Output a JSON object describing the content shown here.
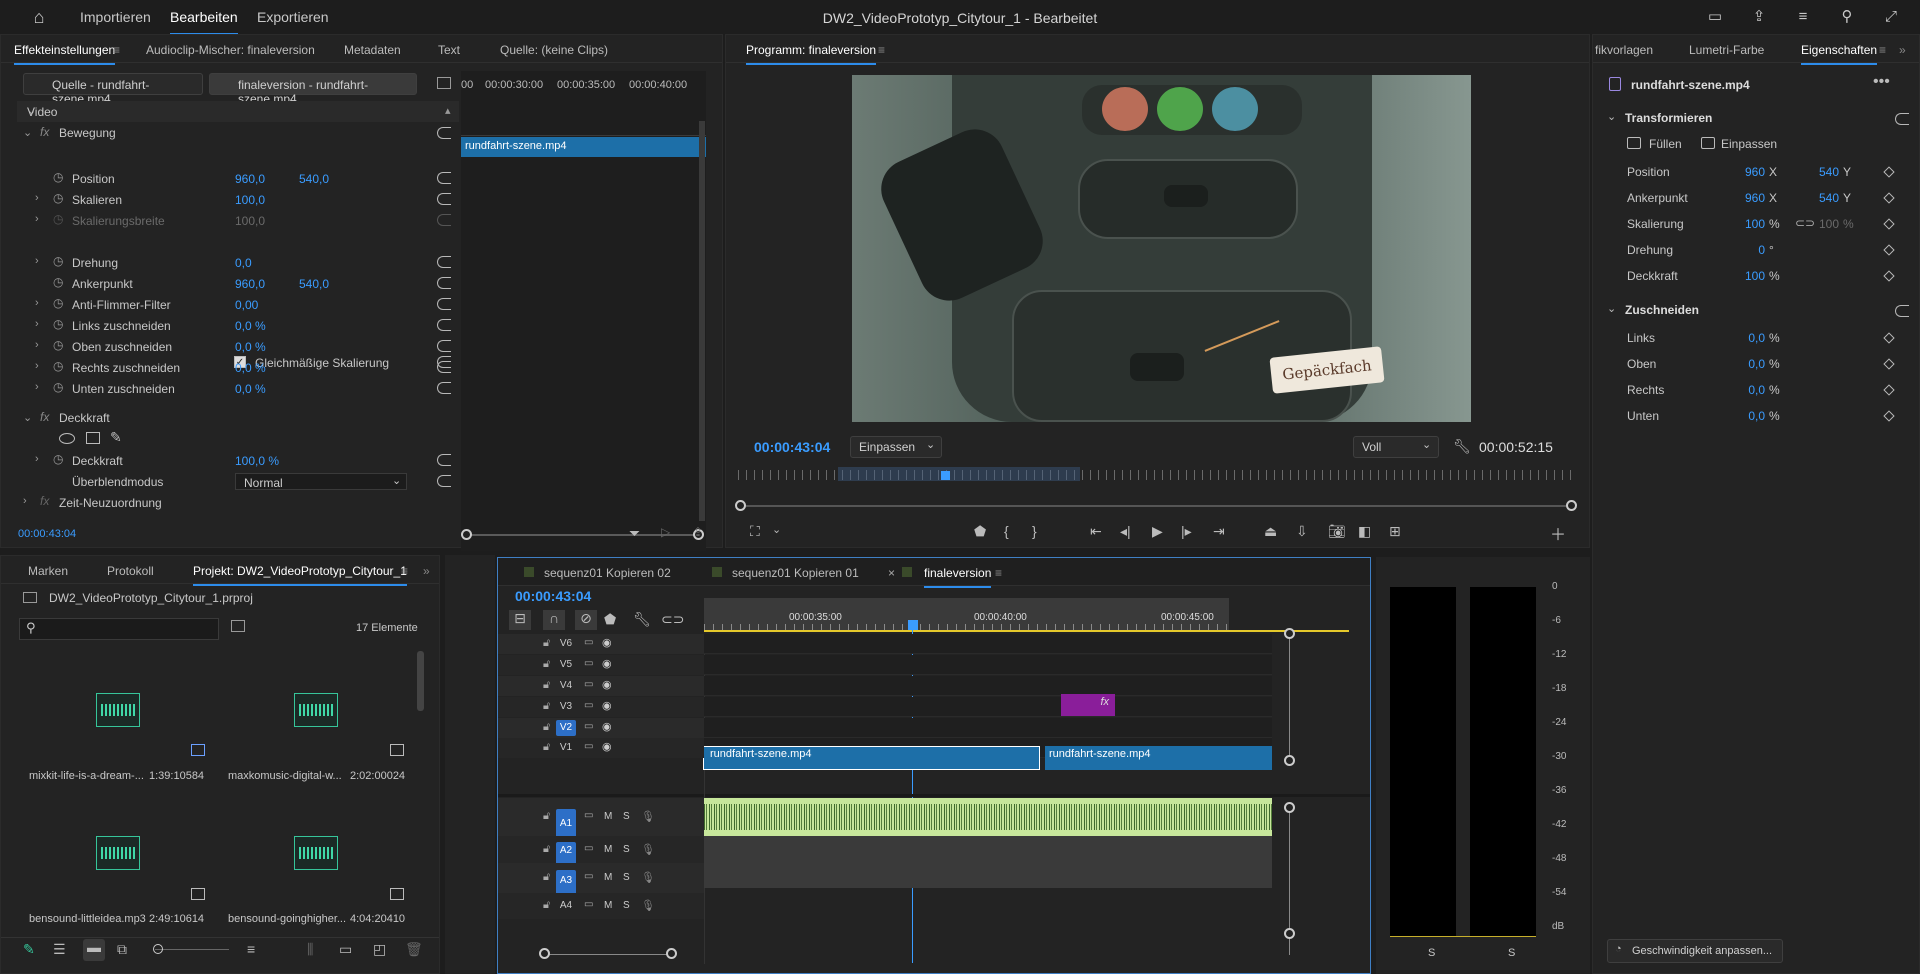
{
  "app": {
    "title": "DW2_VideoPrototyp_Citytour_1 - Bearbeitet",
    "menu": [
      "Importieren",
      "Bearbeiten",
      "Exportieren"
    ]
  },
  "effects_panel": {
    "tabs": [
      "Effekteinstellungen",
      "Audioclip-Mischer: finaleversion",
      "Metadaten",
      "Text",
      "Quelle: (keine Clips)"
    ],
    "source_tab": "Quelle - rundfahrt-szene.mp4",
    "sequence_tab": "finaleversion - rundfahrt-szene.mp4",
    "mini_ruler": [
      "00:00:30:00",
      "00:00:35:00",
      "00:00:40:00"
    ],
    "mini_ruler_start": "00",
    "clip_label": "rundfahrt-szene.mp4",
    "video_header": "Video",
    "motion": {
      "name": "Bewegung",
      "rows": [
        {
          "label": "Position",
          "v1": "960,0",
          "v2": "540,0",
          "expand": false
        },
        {
          "label": "Skalieren",
          "v1": "100,0",
          "v2": "",
          "expand": true
        },
        {
          "label": "Skalierungsbreite",
          "v1": "100,0",
          "v2": "",
          "expand": true,
          "disabled": true
        },
        {
          "label": "Drehung",
          "v1": "0,0",
          "v2": "",
          "expand": true
        },
        {
          "label": "Ankerpunkt",
          "v1": "960,0",
          "v2": "540,0",
          "expand": false
        },
        {
          "label": "Anti-Flimmer-Filter",
          "v1": "0,00",
          "v2": "",
          "expand": true
        },
        {
          "label": "Links zuschneiden",
          "v1": "0,0 %",
          "v2": "",
          "expand": true
        },
        {
          "label": "Oben zuschneiden",
          "v1": "0,0 %",
          "v2": "",
          "expand": true
        },
        {
          "label": "Rechts zuschneiden",
          "v1": "0,0 %",
          "v2": "",
          "expand": true
        },
        {
          "label": "Unten zuschneiden",
          "v1": "0,0 %",
          "v2": "",
          "expand": true
        }
      ],
      "uniform_scale": "Gleichmäßige Skalierung"
    },
    "opacity": {
      "name": "Deckkraft",
      "label": "Deckkraft",
      "value": "100,0 %",
      "blend_label": "Überblendmodus",
      "blend_value": "Normal"
    },
    "time_remap": "Zeit-Neuzuordnung",
    "timecode": "00:00:43:04"
  },
  "program": {
    "title": "Programm: finaleversion",
    "timecode": "00:00:43:04",
    "fit": "Einpassen",
    "quality": "Voll",
    "duration": "00:00:52:15",
    "overlay_label": "Gepäckfach"
  },
  "properties": {
    "tabs": [
      "fikvorlagen",
      "Lumetri-Farbe",
      "Eigenschaften"
    ],
    "clip": "rundfahrt-szene.mp4",
    "transform_title": "Transformieren",
    "fill": "Füllen",
    "fit": "Einpassen",
    "rows": [
      {
        "label": "Position",
        "v1": "960",
        "u1": "X",
        "v2": "540",
        "u2": "Y"
      },
      {
        "label": "Ankerpunkt",
        "v1": "960",
        "u1": "X",
        "v2": "540",
        "u2": "Y"
      },
      {
        "label": "Skalierung",
        "v1": "100",
        "u1": "%",
        "v2": "100",
        "u2": "%"
      },
      {
        "label": "Drehung",
        "v1": "0",
        "u1": "°",
        "v2": "",
        "u2": ""
      },
      {
        "label": "Deckkraft",
        "v1": "100",
        "u1": "%",
        "v2": "",
        "u2": ""
      }
    ],
    "crop_title": "Zuschneiden",
    "crop_rows": [
      {
        "label": "Links",
        "value": "0,0",
        "unit": "%"
      },
      {
        "label": "Oben",
        "value": "0,0",
        "unit": "%"
      },
      {
        "label": "Rechts",
        "value": "0,0",
        "unit": "%"
      },
      {
        "label": "Unten",
        "value": "0,0",
        "unit": "%"
      }
    ],
    "speed_button": "Geschwindigkeit anpassen..."
  },
  "project": {
    "tabs": [
      "Marken",
      "Protokoll",
      "Projekt: DW2_VideoPrototyp_Citytour_1"
    ],
    "file": "DW2_VideoPrototyp_Citytour_1.prproj",
    "count": "17 Elemente",
    "items": [
      {
        "name": "mixkit-life-is-a-dream-...",
        "duration": "1:39:10584"
      },
      {
        "name": "maxkomusic-digital-w...",
        "duration": "2:02:00024"
      },
      {
        "name": "bensound-littleidea.mp3",
        "duration": "2:49:10614"
      },
      {
        "name": "bensound-goinghigher...",
        "duration": "4:04:20410"
      }
    ]
  },
  "timeline": {
    "tabs": [
      "sequenz01 Kopieren 02",
      "sequenz01 Kopieren 01",
      "finaleversion"
    ],
    "timecode": "00:00:43:04",
    "ruler": [
      "00:00:35:00",
      "00:00:40:00",
      "00:00:45:00"
    ],
    "video_tracks": [
      "V6",
      "V5",
      "V4",
      "V3",
      "V2",
      "V1"
    ],
    "audio_tracks": [
      "A1",
      "A2",
      "A3",
      "A4"
    ],
    "clip_a": "rundfahrt-szene.mp4",
    "clip_b": "rundfahrt-szene.mp4",
    "fx": "fx",
    "m": "M",
    "s": "S"
  },
  "meter": {
    "scale": [
      "0",
      "-6",
      "-12",
      "-18",
      "-24",
      "-30",
      "-36",
      "-42",
      "-48",
      "-54",
      "dB"
    ],
    "channels": [
      "S",
      "S"
    ]
  }
}
